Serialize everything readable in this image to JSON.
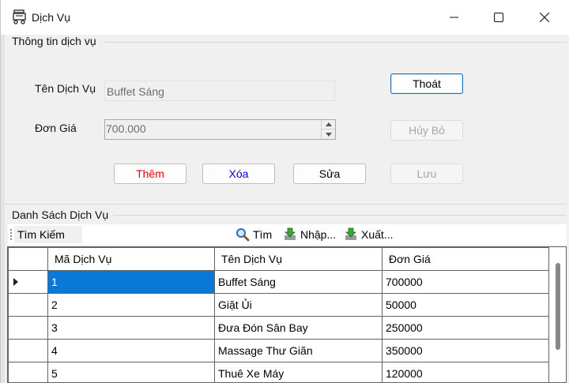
{
  "window": {
    "title": "Dịch Vụ",
    "icon": "service-cart-icon"
  },
  "info_group": {
    "title": "Thông tin dịch vụ"
  },
  "form": {
    "name_label": "Tên Dịch Vụ",
    "name_value": "Buffet Sáng",
    "price_label": "Đơn Giá",
    "price_value": "700.000"
  },
  "buttons": {
    "exit": "Thoát",
    "cancel": "Hủy Bỏ",
    "add": "Thêm",
    "delete": "Xóa",
    "edit": "Sửa",
    "save": "Lưu"
  },
  "colors": {
    "add_text": "#e00000",
    "delete_text": "#0000cc",
    "selection": "#0a78d7"
  },
  "list_group": {
    "title": "Danh Sách Dịch Vụ"
  },
  "toolbar": {
    "search_label": "Tìm Kiếm",
    "find": "Tìm",
    "import": "Nhập...",
    "export": "Xuất..."
  },
  "table": {
    "columns": [
      "Mã Dịch Vụ",
      "Tên Dịch Vụ",
      "Đơn Giá"
    ],
    "rows": [
      [
        "1",
        "Buffet Sáng",
        "700000"
      ],
      [
        "2",
        "Giặt Ủi",
        "50000"
      ],
      [
        "3",
        "Đưa Đón Sân Bay",
        "250000"
      ],
      [
        "4",
        "Massage Thư Giãn",
        "350000"
      ],
      [
        "5",
        "Thuê Xe Máy",
        "120000"
      ]
    ]
  }
}
